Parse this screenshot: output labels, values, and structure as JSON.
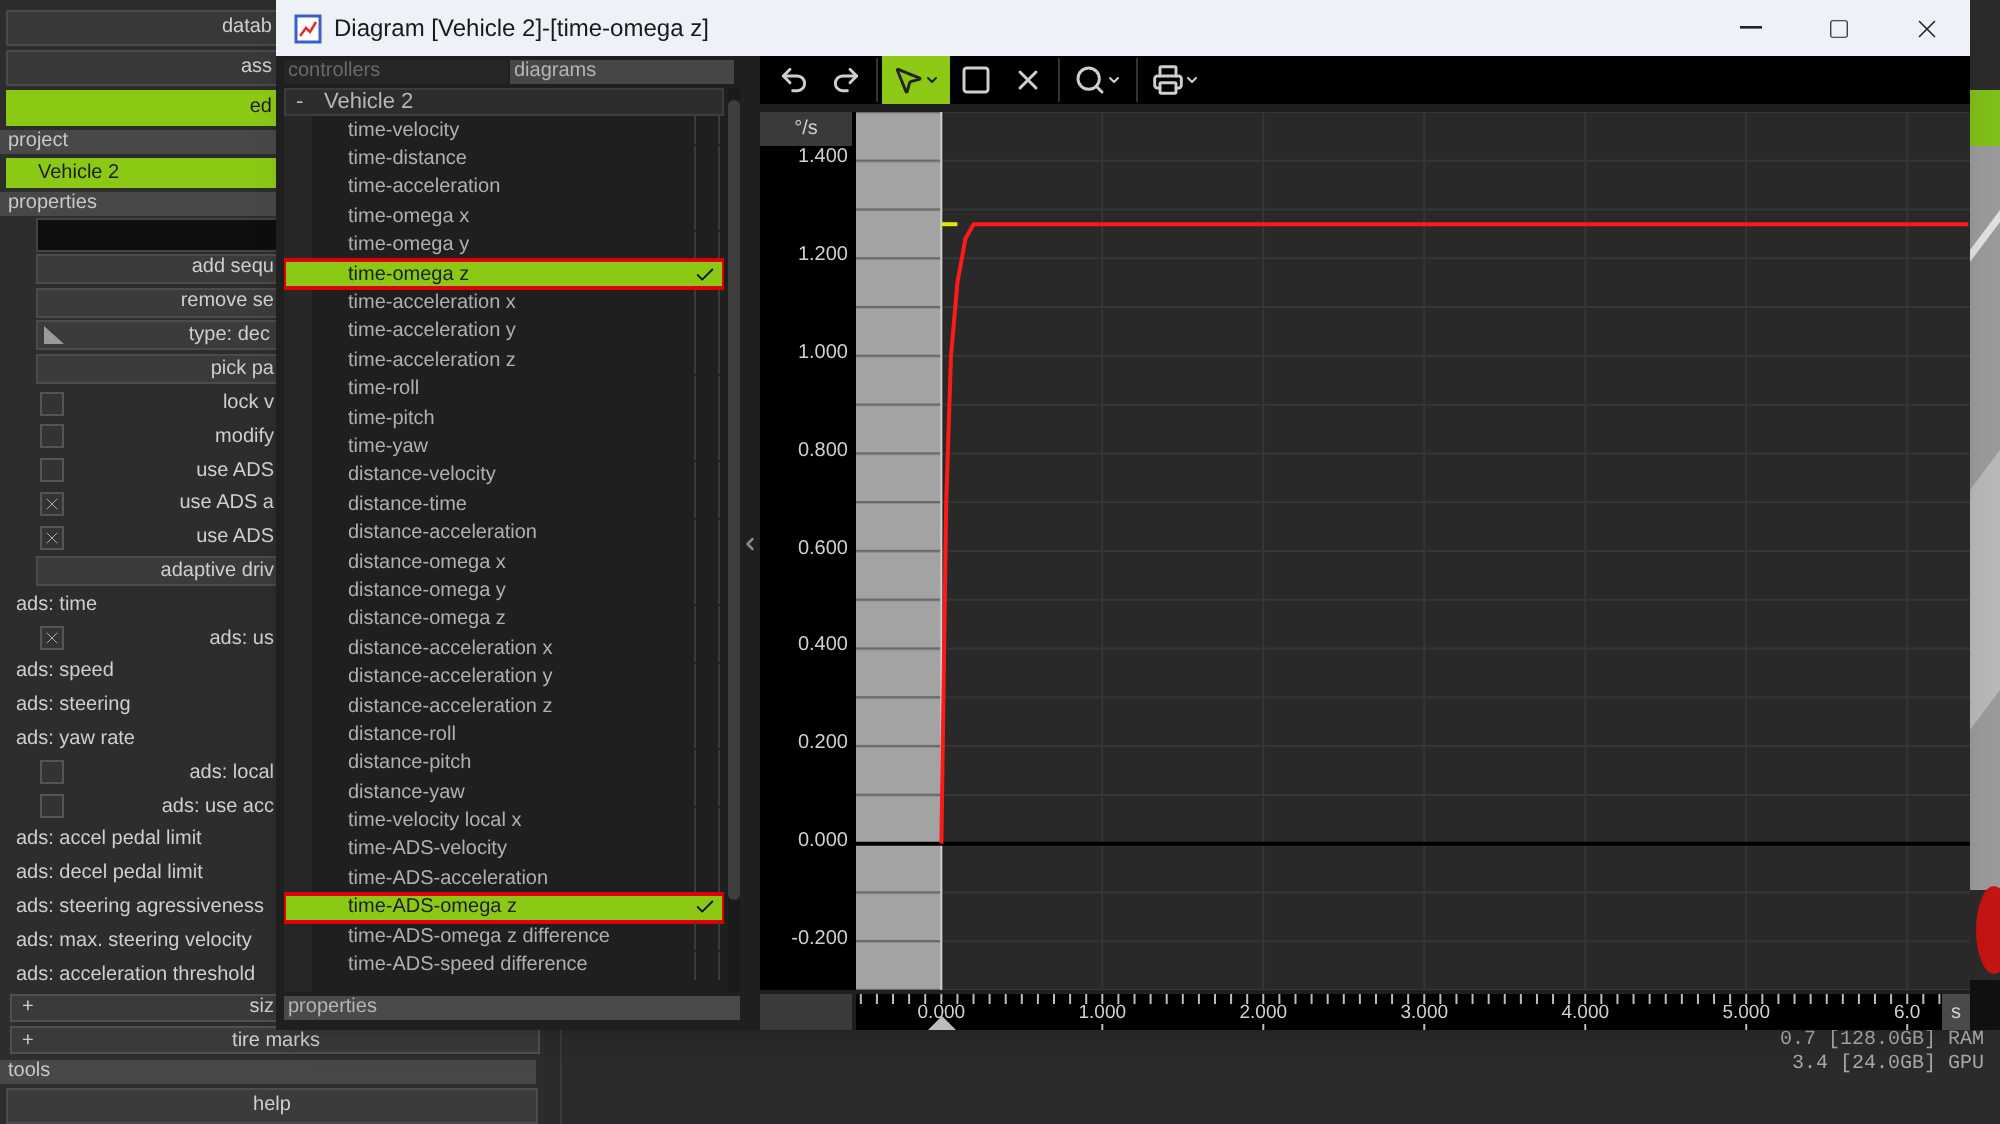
{
  "panel": {
    "top_buttons": [
      {
        "label": "datab",
        "active": false
      },
      {
        "label": "ass",
        "active": false
      },
      {
        "label": "ed",
        "active": true
      }
    ],
    "project": {
      "title": "project",
      "items": [
        {
          "label": "Vehicle 2",
          "selected": true
        }
      ]
    },
    "properties": {
      "title": "properties",
      "items": [
        {
          "kind": "field"
        },
        {
          "kind": "button",
          "label": "add sequ"
        },
        {
          "kind": "button",
          "label": "remove se"
        },
        {
          "kind": "type_button",
          "label": "type: dec"
        },
        {
          "kind": "button",
          "label": "pick pa"
        },
        {
          "kind": "checkbox",
          "label": "lock v",
          "checked": false
        },
        {
          "kind": "checkbox",
          "label": "modify",
          "checked": false
        },
        {
          "kind": "checkbox",
          "label": "use ADS",
          "checked": false
        },
        {
          "kind": "checkbox",
          "label": "use ADS a",
          "checked": true
        },
        {
          "kind": "checkbox",
          "label": "use ADS",
          "checked": true
        },
        {
          "kind": "button",
          "label": "adaptive driv"
        },
        {
          "kind": "label",
          "label": "ads: time"
        },
        {
          "kind": "checkbox",
          "label": "ads: us",
          "checked": true
        },
        {
          "kind": "label",
          "label": "ads: speed"
        },
        {
          "kind": "label",
          "label": "ads: steering"
        },
        {
          "kind": "label",
          "label": "ads: yaw rate"
        },
        {
          "kind": "checkbox",
          "label": "ads: local",
          "checked": false
        },
        {
          "kind": "checkbox",
          "label": "ads: use acc",
          "checked": false
        },
        {
          "kind": "label",
          "label": "ads: accel pedal limit"
        },
        {
          "kind": "label",
          "label": "ads: decel pedal limit"
        },
        {
          "kind": "label",
          "label": "ads: steering agressiveness"
        },
        {
          "kind": "label",
          "label": "ads: max. steering velocity"
        },
        {
          "kind": "label",
          "label": "ads: acceleration threshold"
        },
        {
          "kind": "section",
          "toggle": "+",
          "label": "siz"
        }
      ]
    },
    "bottom": [
      {
        "kind": "section",
        "toggle": "+",
        "label": "tire marks"
      },
      {
        "kind": "header",
        "label": "tools"
      },
      {
        "kind": "button",
        "label": "help"
      }
    ]
  },
  "status": [
    "0.7 [128.0GB] RAM",
    "3.4 [24.0GB] GPU"
  ],
  "dialog": {
    "title": "Diagram [Vehicle 2]-[time-omega z]",
    "tabs": [
      {
        "label": "controllers",
        "selected": false
      },
      {
        "label": "diagrams",
        "selected": true
      }
    ],
    "tree": {
      "toggle": "-",
      "label": "Vehicle 2",
      "expanded": true,
      "children": [
        {
          "label": "time-velocity",
          "checked": false
        },
        {
          "label": "time-distance",
          "checked": false
        },
        {
          "label": "time-acceleration",
          "checked": false
        },
        {
          "label": "time-omega x",
          "checked": false
        },
        {
          "label": "time-omega y",
          "checked": false
        },
        {
          "label": "time-omega z",
          "checked": true
        },
        {
          "label": "time-acceleration x",
          "checked": false
        },
        {
          "label": "time-acceleration y",
          "checked": false
        },
        {
          "label": "time-acceleration z",
          "checked": false
        },
        {
          "label": "time-roll",
          "checked": false
        },
        {
          "label": "time-pitch",
          "checked": false
        },
        {
          "label": "time-yaw",
          "checked": false
        },
        {
          "label": "distance-velocity",
          "checked": false
        },
        {
          "label": "distance-time",
          "checked": false
        },
        {
          "label": "distance-acceleration",
          "checked": false
        },
        {
          "label": "distance-omega x",
          "checked": false
        },
        {
          "label": "distance-omega y",
          "checked": false
        },
        {
          "label": "distance-omega z",
          "checked": false
        },
        {
          "label": "distance-acceleration x",
          "checked": false
        },
        {
          "label": "distance-acceleration y",
          "checked": false
        },
        {
          "label": "distance-acceleration z",
          "checked": false
        },
        {
          "label": "distance-roll",
          "checked": false
        },
        {
          "label": "distance-pitch",
          "checked": false
        },
        {
          "label": "distance-yaw",
          "checked": false
        },
        {
          "label": "time-velocity local x",
          "checked": false
        },
        {
          "label": "time-ADS-velocity",
          "checked": false
        },
        {
          "label": "time-ADS-acceleration",
          "checked": false
        },
        {
          "label": "time-ADS-omega z",
          "checked": true
        },
        {
          "label": "time-ADS-omega z difference",
          "checked": false
        },
        {
          "label": "time-ADS-speed difference",
          "checked": false
        }
      ]
    },
    "properties_bar": "properties",
    "toolbar": [
      {
        "selected": false,
        "has_menu": false
      },
      {
        "selected": false,
        "has_menu": false
      },
      {
        "selected": true,
        "has_menu": true
      },
      {
        "selected": false,
        "has_menu": false
      },
      {
        "selected": false,
        "has_menu": false
      },
      {
        "selected": false,
        "has_menu": true
      },
      {
        "selected": false,
        "has_menu": true
      }
    ],
    "chart_data": {
      "type": "line",
      "xlabel": "s",
      "ylabel": "°/s",
      "x": [
        0,
        0.03,
        0.06,
        0.1,
        0.15,
        0.2,
        6.38
      ],
      "series": [
        {
          "color": "#e6e600",
          "values": [
            1.27,
            1.27,
            1.27,
            1.27,
            null,
            null,
            null
          ]
        },
        {
          "color": "#ff1a1a",
          "values": [
            0,
            0.7,
            1.0,
            1.15,
            1.24,
            1.27,
            1.27
          ]
        }
      ],
      "grid": true,
      "bands": [
        {
          "axis": "x",
          "from": -0.53,
          "to": 0
        }
      ],
      "ref_lines": [
        {
          "axis": "x",
          "value": 0
        }
      ],
      "xlim": [
        -0.53,
        6.39
      ],
      "ylim": [
        -0.3,
        1.5
      ],
      "xticks": [
        {
          "value": 0,
          "label": "0.000"
        },
        {
          "value": 1,
          "label": "1.000"
        },
        {
          "value": 2,
          "label": "2.000"
        },
        {
          "value": 3,
          "label": "3.000"
        },
        {
          "value": 4,
          "label": "4.000"
        },
        {
          "value": 5,
          "label": "5.000"
        },
        {
          "value": 6,
          "label": "6.0"
        }
      ],
      "yticks": [
        {
          "value": -0.2,
          "label": "-0.200"
        },
        {
          "value": 0,
          "label": "0.000"
        },
        {
          "value": 0.2,
          "label": "0.200"
        },
        {
          "value": 0.4,
          "label": "0.400"
        },
        {
          "value": 0.6,
          "label": "0.600"
        },
        {
          "value": 0.8,
          "label": "0.800"
        },
        {
          "value": 1,
          "label": "1.000"
        },
        {
          "value": 1.2,
          "label": "1.200"
        },
        {
          "value": 1.4,
          "label": "1.400"
        }
      ]
    }
  }
}
